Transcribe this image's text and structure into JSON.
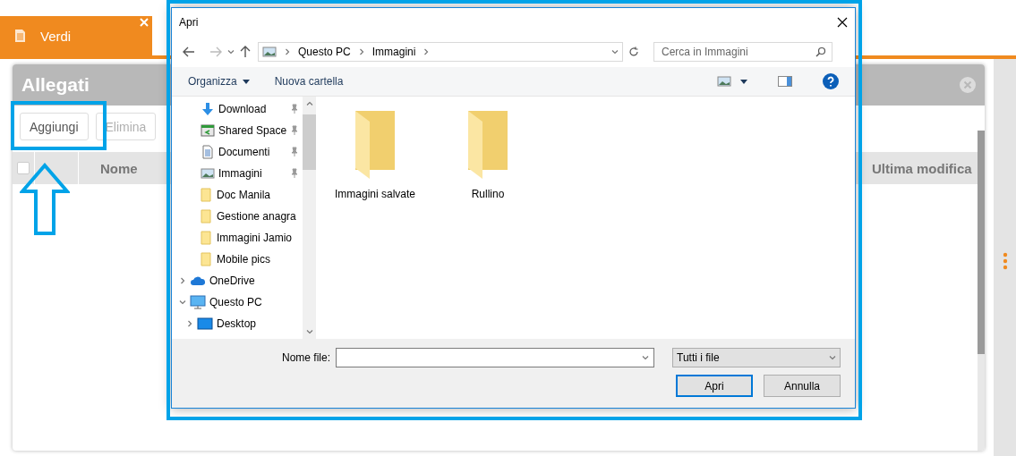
{
  "app_tab": {
    "label": "Verdi",
    "selected": true
  },
  "modal": {
    "title": "Allegati",
    "buttons": [
      {
        "label": "Aggiungi",
        "disabled": false
      },
      {
        "label": "Elimina",
        "disabled": true
      }
    ],
    "table": {
      "select_all": {
        "checked": false
      },
      "columns": [
        "Nome",
        "Ultima modifica"
      ]
    }
  },
  "dialog": {
    "title": "Apri",
    "breadcrumb": [
      "Questo PC",
      "Immagini"
    ],
    "search": {
      "placeholder": "Cerca in Immagini"
    },
    "toolbar": [
      {
        "label": "Organizza",
        "menu": true
      },
      {
        "label": "Nuova cartella",
        "menu": false
      }
    ],
    "nav_items": [
      {
        "label": "Download",
        "kind": "download",
        "pinned": true
      },
      {
        "label": "Shared Space",
        "kind": "shared",
        "pinned": true
      },
      {
        "label": "Documenti",
        "kind": "document",
        "pinned": true
      },
      {
        "label": "Immagini",
        "kind": "pictures",
        "pinned": true
      },
      {
        "label": "Doc Manila",
        "kind": "folder",
        "pinned": false
      },
      {
        "label": "Gestione anagra",
        "kind": "folder",
        "pinned": false
      },
      {
        "label": "Immagini Jamio",
        "kind": "folder",
        "pinned": false
      },
      {
        "label": "Mobile pics",
        "kind": "folder",
        "pinned": false
      },
      {
        "label": "OneDrive",
        "kind": "cloud",
        "expanded": false
      },
      {
        "label": "Questo PC",
        "kind": "pc",
        "expanded": true,
        "children": [
          {
            "label": "Desktop",
            "kind": "desktop",
            "expanded": false
          }
        ]
      }
    ],
    "folders": [
      {
        "name": "Immagini salvate"
      },
      {
        "name": "Rullino"
      }
    ],
    "file_name_label": "Nome file:",
    "file_type": "Tutti i file",
    "buttons": [
      {
        "label": "Apri",
        "default": true
      },
      {
        "label": "Annulla",
        "default": false
      }
    ]
  }
}
